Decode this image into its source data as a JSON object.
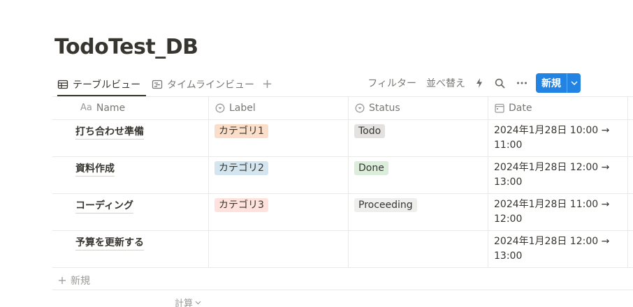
{
  "page": {
    "title": "TodoTest_DB"
  },
  "views": {
    "tabs": [
      {
        "label": "テーブルビュー",
        "icon": "table-icon",
        "active": true
      },
      {
        "label": "タイムラインビュー",
        "icon": "timeline-icon",
        "active": false
      }
    ],
    "add_view_icon": "+"
  },
  "toolbar": {
    "filter_label": "フィルター",
    "sort_label": "並べ替え",
    "new_label": "新規",
    "accent": "#2383e2"
  },
  "columns": [
    {
      "label": "Name",
      "icon": "text-property-icon",
      "icon_text": "Aa"
    },
    {
      "label": "Label",
      "icon": "select-property-icon"
    },
    {
      "label": "Status",
      "icon": "select-property-icon"
    },
    {
      "label": "Date",
      "icon": "calendar-icon"
    }
  ],
  "rows": [
    {
      "name": "打ち合わせ準備",
      "label": "カテゴリ1",
      "label_color": "#fadec9",
      "status": "Todo",
      "status_color": "#e3e2e0",
      "date_line1": "2024年1月28日 10:00 →",
      "date_line2": "11:00"
    },
    {
      "name": "資料作成",
      "label": "カテゴリ2",
      "label_color": "#d3e5ef",
      "status": "Done",
      "status_color": "#dbeddb",
      "date_line1": "2024年1月28日 12:00 →",
      "date_line2": "13:00"
    },
    {
      "name": "コーディング",
      "label": "カテゴリ3",
      "label_color": "#ffe2dd",
      "status": "Proceeding",
      "status_color": "#eeeeec",
      "date_line1": "2024年1月28日 11:00 →",
      "date_line2": "12:00"
    },
    {
      "name": "予算を更新する",
      "label": "",
      "label_color": "",
      "status": "",
      "status_color": "",
      "date_line1": "2024年1月28日 12:00 →",
      "date_line2": "13:00"
    }
  ],
  "footer": {
    "add_row_label": "新規",
    "calc_label": "計算"
  }
}
